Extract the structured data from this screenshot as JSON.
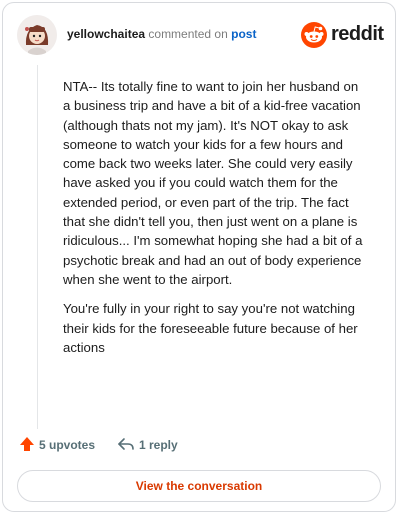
{
  "comment": {
    "username": "yellowchaitea",
    "action_text": "commented on",
    "target_text": "post",
    "paragraphs": [
      "NTA-- Its totally fine to want to join her husband on a business trip and have a bit of a kid-free vacation (although thats not my jam). It's NOT okay to ask someone to watch your kids for a few hours and come back two weeks later. She could very easily have asked you if you could watch them for the extended period, or even part of the trip. The fact that she didn't tell you, then just went on a plane is ridiculous... I'm somewhat hoping she had a bit of a psychotic break and had an out of body experience when she went to the airport.",
      "You're fully in your right to say you're not watching their kids for the foreseeable future because of her actions"
    ],
    "upvotes_label": "5 upvotes",
    "replies_label": "1 reply"
  },
  "brand": {
    "name": "reddit",
    "color": "#ff4500"
  },
  "cta": {
    "label": "View the conversation",
    "color": "#d93900"
  }
}
